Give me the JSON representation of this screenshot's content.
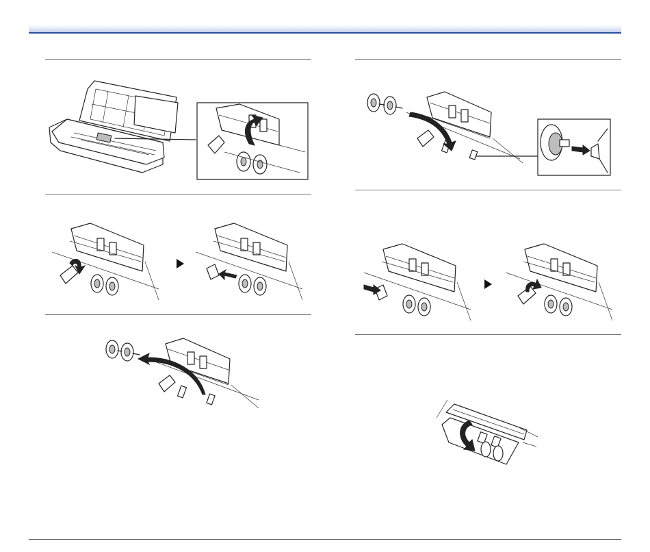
{
  "page": {
    "accent_color": "#2a4fa0"
  },
  "icons": {
    "next_step": "right-triangle-arrow",
    "rotate": "curved-arrow"
  }
}
